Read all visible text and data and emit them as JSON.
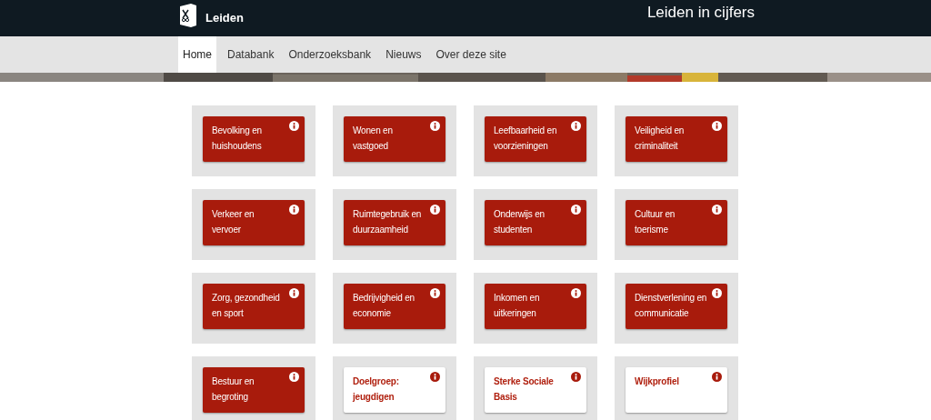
{
  "header": {
    "logo_text": "Leiden",
    "site_title": "Leiden in cijfers"
  },
  "nav": [
    {
      "label": "Home",
      "selected": true
    },
    {
      "label": "Databank",
      "selected": false
    },
    {
      "label": "Onderzoeksbank",
      "selected": false
    },
    {
      "label": "Nieuws",
      "selected": false
    },
    {
      "label": "Over deze site",
      "selected": false
    }
  ],
  "tiles": [
    {
      "label": "Bevolking en huishoudens",
      "kind": "theme"
    },
    {
      "label": "Wonen en vastgoed",
      "kind": "theme"
    },
    {
      "label": "Leefbaarheid en voorzieningen",
      "kind": "theme"
    },
    {
      "label": "Veiligheid en criminaliteit",
      "kind": "theme"
    },
    {
      "label": "Verkeer en vervoer",
      "kind": "theme"
    },
    {
      "label": "Ruimtegebruik en duurzaamheid",
      "kind": "theme"
    },
    {
      "label": "Onderwijs en studenten",
      "kind": "theme"
    },
    {
      "label": "Cultuur en toerisme",
      "kind": "theme"
    },
    {
      "label": "Zorg, gezondheid en sport",
      "kind": "theme"
    },
    {
      "label": "Bedrijvigheid en economie",
      "kind": "theme"
    },
    {
      "label": "Inkomen en uitkeringen",
      "kind": "theme"
    },
    {
      "label": "Dienstverlening en communicatie",
      "kind": "theme"
    },
    {
      "label": "Bestuur en begroting",
      "kind": "theme"
    },
    {
      "label": "Doelgroep: jeugdigen",
      "kind": "profile"
    },
    {
      "label": "Sterke Sociale Basis",
      "kind": "profile"
    },
    {
      "label": "Wijkprofiel",
      "kind": "profile"
    }
  ]
}
